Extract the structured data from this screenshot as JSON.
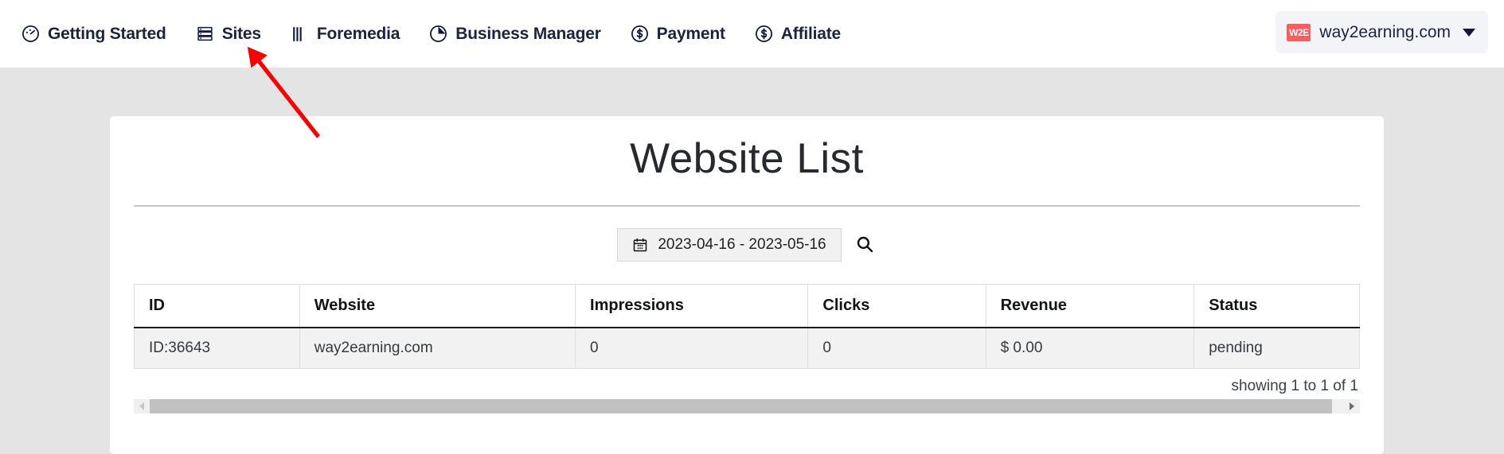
{
  "nav": {
    "items": [
      {
        "label": "Getting Started",
        "icon": "gauge-icon"
      },
      {
        "label": "Sites",
        "icon": "server-stack-icon"
      },
      {
        "label": "Foremedia",
        "icon": "bars-icon"
      },
      {
        "label": "Business Manager",
        "icon": "pie-chart-icon"
      },
      {
        "label": "Payment",
        "icon": "dollar-circle-icon"
      },
      {
        "label": "Affiliate",
        "icon": "dollar-circle-icon"
      }
    ]
  },
  "account": {
    "badge_text": "W2E",
    "badge_color": "#fb5d5d",
    "name": "way2earning.com",
    "caret_icon": "chevron-down-icon"
  },
  "main": {
    "title": "Website List",
    "filter": {
      "calendar_icon": "calendar-icon",
      "date_range": "2023-04-16 - 2023-05-16",
      "search_icon": "search-icon"
    },
    "table": {
      "columns": [
        "ID",
        "Website",
        "Impressions",
        "Clicks",
        "Revenue",
        "Status"
      ],
      "rows": [
        [
          "ID:36643",
          "way2earning.com",
          "0",
          "0",
          "$ 0.00",
          "pending"
        ]
      ]
    },
    "showing": "showing 1 to 1 of 1",
    "scrollbar": {
      "left_arrow_icon": "triangle-left-icon",
      "right_arrow_icon": "triangle-right-icon"
    }
  },
  "annotation": {
    "arrow_color": "#fb0000",
    "target": "Sites"
  }
}
